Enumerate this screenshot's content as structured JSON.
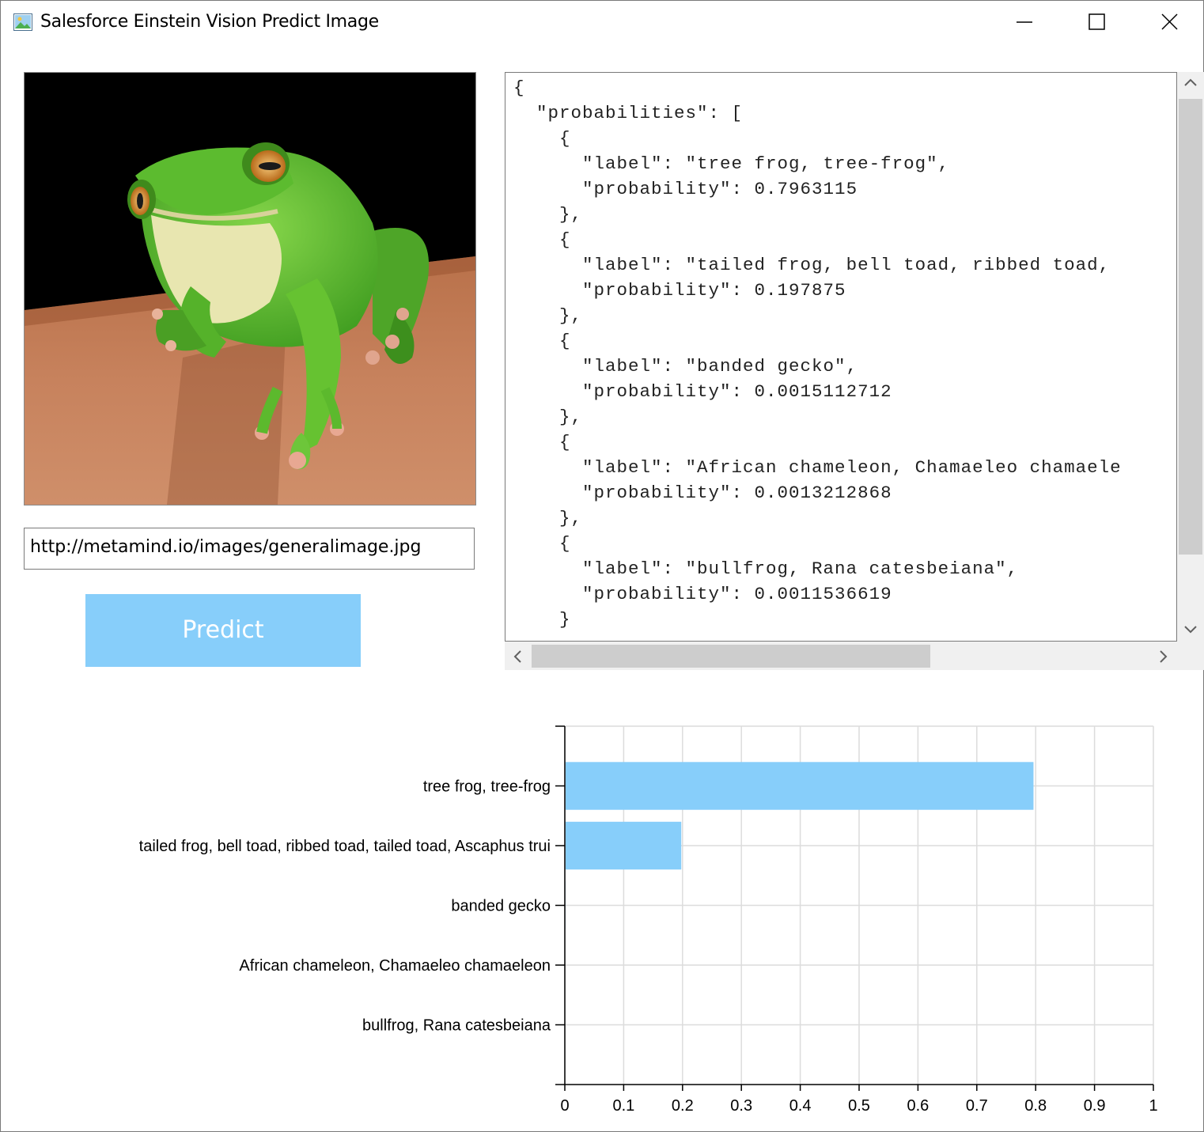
{
  "window": {
    "title": "Salesforce Einstein Vision Predict Image",
    "app_icon": "image-app-icon",
    "controls": [
      "minimize-icon",
      "maximize-icon",
      "close-icon"
    ]
  },
  "image_panel": {
    "description_icon": "frog-photo"
  },
  "url_input": {
    "value": "http://metamind.io/images/generalimage.jpg"
  },
  "predict_button": {
    "label": "Predict",
    "color": "#87CEFA"
  },
  "json_output": {
    "lines": [
      "{",
      "  \"probabilities\": [",
      "    {",
      "      \"label\": \"tree frog, tree-frog\",",
      "      \"probability\": 0.7963115",
      "    },",
      "    {",
      "      \"label\": \"tailed frog, bell toad, ribbed toad,",
      "      \"probability\": 0.197875",
      "    },",
      "    {",
      "      \"label\": \"banded gecko\",",
      "      \"probability\": 0.0015112712",
      "    },",
      "    {",
      "      \"label\": \"African chameleon, Chamaeleo chamaele",
      "      \"probability\": 0.0013212868",
      "    },",
      "    {",
      "      \"label\": \"bullfrog, Rana catesbeiana\",",
      "      \"probability\": 0.0011536619",
      "    }"
    ]
  },
  "chart_data": {
    "type": "bar",
    "orientation": "horizontal",
    "categories": [
      "tree frog, tree-frog",
      "tailed frog, bell toad, ribbed toad, tailed toad, Ascaphus trui",
      "banded gecko",
      "African chameleon, Chamaeleo chamaeleon",
      "bullfrog, Rana catesbeiana"
    ],
    "values": [
      0.7963115,
      0.197875,
      0.0015112712,
      0.0013212868,
      0.0011536619
    ],
    "xlim": [
      0,
      1
    ],
    "xticks": [
      "0",
      "0.1",
      "0.2",
      "0.3",
      "0.4",
      "0.5",
      "0.6",
      "0.7",
      "0.8",
      "0.9",
      "1"
    ],
    "grid": true,
    "bar_color": "#87CEFA",
    "grid_color": "#DCDCDC"
  }
}
